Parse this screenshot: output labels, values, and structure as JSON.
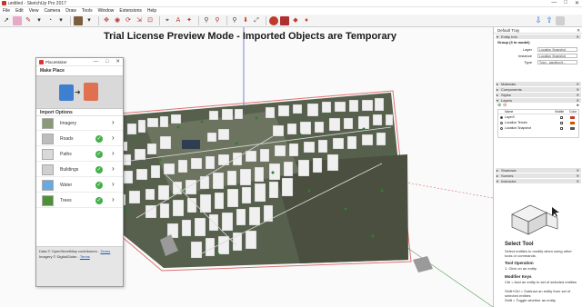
{
  "window": {
    "title": "untitled - SketchUp Pro 2017",
    "controls": [
      "—",
      "□",
      "✕"
    ]
  },
  "menu": [
    "File",
    "Edit",
    "View",
    "Camera",
    "Draw",
    "Tools",
    "Window",
    "Extensions",
    "Help"
  ],
  "toolbar": {
    "icons": [
      "select-icon",
      "eraser-icon",
      "pencil-icon",
      "line-icon",
      "rectangle-icon",
      "shape-icon",
      "pushpull-icon",
      "move-icon",
      "rotate-icon",
      "scale-icon",
      "offset-icon",
      "tape-icon",
      "text-icon",
      "axes-icon",
      "paint-icon",
      "orbit-icon",
      "pan-icon",
      "zoom-icon",
      "zoom-extents-icon",
      "warehouse-icon",
      "extension-warehouse-icon",
      "layout-icon",
      "ruby-icon",
      "placemaker-download-icon",
      "placemaker-upload-icon",
      "user-icon"
    ]
  },
  "viewport": {
    "watermark": "Trial License Preview Mode - Imported Objects are Temporary"
  },
  "placemaker": {
    "title": "PlaceMaker",
    "controls": [
      "—",
      "□",
      "✕"
    ],
    "make_place_label": "Make Place",
    "import_options_label": "Import Options",
    "options": [
      {
        "label": "Imagery",
        "checked": false
      },
      {
        "label": "Roads",
        "checked": true
      },
      {
        "label": "Paths",
        "checked": true
      },
      {
        "label": "Buildings",
        "checked": true
      },
      {
        "label": "Water",
        "checked": true
      },
      {
        "label": "Trees",
        "checked": true
      }
    ],
    "footer": {
      "data_credit": "Data © OpenStreetMap contributors - ",
      "imagery_credit": "Imagery © DigitalGlobe - ",
      "link_text": "Terms"
    }
  },
  "tray": {
    "title": "Default Tray",
    "entity_info": {
      "header": "Entity Info",
      "group": "Group (3 in model)",
      "fields": [
        {
          "label": "Layer",
          "value": "Location Snapshot"
        },
        {
          "label": "Instance",
          "value": "Location Snapshot"
        },
        {
          "label": "Type",
          "value": "Topo - sandbox/t..."
        }
      ]
    },
    "panels": [
      "Materials",
      "Components",
      "Styles",
      "Layers"
    ],
    "layers": {
      "columns": [
        "Name",
        "Visible",
        "Color"
      ],
      "rows": [
        {
          "name": "Layer0",
          "active": true,
          "visible": true,
          "color": "#c0392b"
        },
        {
          "name": "Location Terrain",
          "active": false,
          "visible": true,
          "color": "#d35400"
        },
        {
          "name": "Location Snapshot",
          "active": false,
          "visible": true,
          "color": "#555555"
        }
      ]
    },
    "lower_panels": [
      "Shadows",
      "Scenes",
      "Instructor"
    ],
    "instructor": {
      "tool_name": "Select Tool",
      "tool_desc": "Select entities to modify when using other tools or commands.",
      "operation_title": "Tool Operation",
      "operation_step": "1.  Click on an entity",
      "modifier_title": "Modifier Keys",
      "modifier_lines": [
        "Ctrl = Add an entity to set of selected entities",
        "Shift+Ctrl = Subtract an entity from set of selected entities",
        "Shift = Toggle whether an entity"
      ]
    }
  },
  "colors": {
    "ground_dark": "#3a3f33",
    "boundary": "#e07070",
    "vegetation": "#2e7d32",
    "accent_check": "#44b04a"
  }
}
